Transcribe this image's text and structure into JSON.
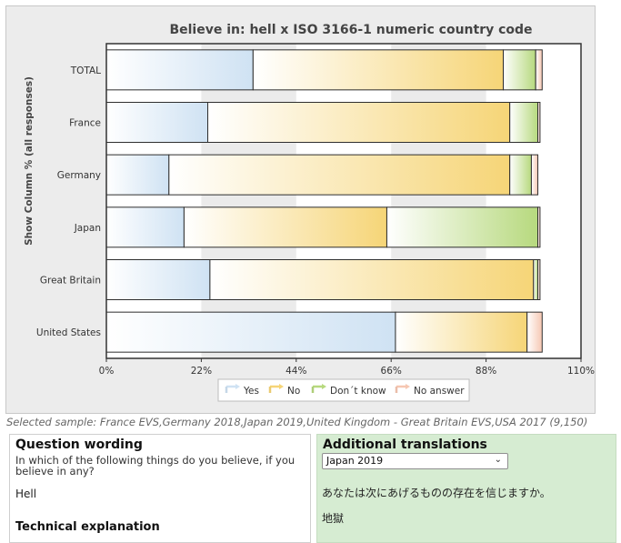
{
  "chart_data": {
    "type": "bar",
    "orientation": "horizontal",
    "stacked": true,
    "title": "Believe in: hell x ISO 3166-1 numeric country code",
    "ylabel": "Show Column % (all responses)",
    "categories": [
      "TOTAL",
      "France",
      "Germany",
      "Japan",
      "Great Britain",
      "United States"
    ],
    "x_ticks": [
      "0%",
      "22%",
      "44%",
      "66%",
      "88%",
      "110%"
    ],
    "xlim": [
      0,
      110
    ],
    "grid": "vertical alternating bands",
    "legend_position": "bottom",
    "series": [
      {
        "name": "Yes",
        "values": [
          34,
          23.5,
          14.5,
          18,
          24,
          67
        ],
        "color": "#cfe2f3"
      },
      {
        "name": "No",
        "values": [
          58,
          70,
          79,
          47,
          75,
          30.5
        ],
        "color": "#f6d577"
      },
      {
        "name": "Don´t know",
        "values": [
          7.5,
          6.5,
          5,
          35,
          1,
          0
        ],
        "color": "#b7d97e"
      },
      {
        "name": "No answer",
        "values": [
          1.5,
          0.5,
          1.5,
          0.5,
          0.5,
          3.5
        ],
        "color": "#f6c7b2"
      }
    ]
  },
  "sample_text": "Selected sample: France EVS,Germany 2018,Japan 2019,United Kingdom - Great Britain EVS,USA 2017 (9,150)",
  "question": {
    "heading": "Question wording",
    "text": "In which of the following things do you believe, if you believe in any?",
    "item": "Hell",
    "next_heading": "Technical explanation"
  },
  "translations": {
    "heading": "Additional translations",
    "selected": "Japan 2019",
    "text": "あなたは次にあげるものの存在を信じますか。",
    "item": "地獄"
  }
}
